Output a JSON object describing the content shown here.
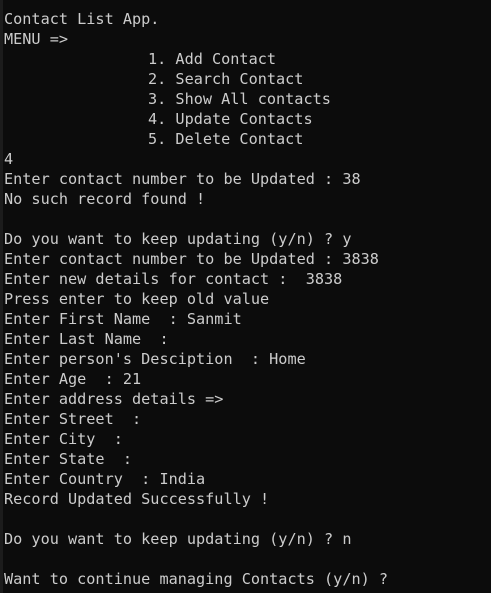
{
  "console": {
    "title_line": "Contact List App.",
    "menu_label": "MENU =>",
    "menu_options": [
      "1. Add Contact",
      "2. Search Contact",
      "3. Show All contacts",
      "4. Update Contacts",
      "5. Delete Contact"
    ],
    "output_lines": [
      "4",
      "Enter contact number to be Updated : 38",
      "No such record found !",
      "",
      "Do you want to keep updating (y/n) ? y",
      "Enter contact number to be Updated : 3838",
      "Enter new details for contact :  3838",
      "Press enter to keep old value",
      "Enter First Name  : Sanmit",
      "Enter Last Name  :",
      "Enter person's Desciption  : Home",
      "Enter Age  : 21",
      "Enter address details =>",
      "Enter Street  :",
      "Enter City  :",
      "Enter State  :",
      "Enter Country  : India",
      "Record Updated Successfully !",
      "",
      "Do you want to keep updating (y/n) ? n",
      "",
      "Want to continue managing Contacts (y/n) ?"
    ]
  }
}
